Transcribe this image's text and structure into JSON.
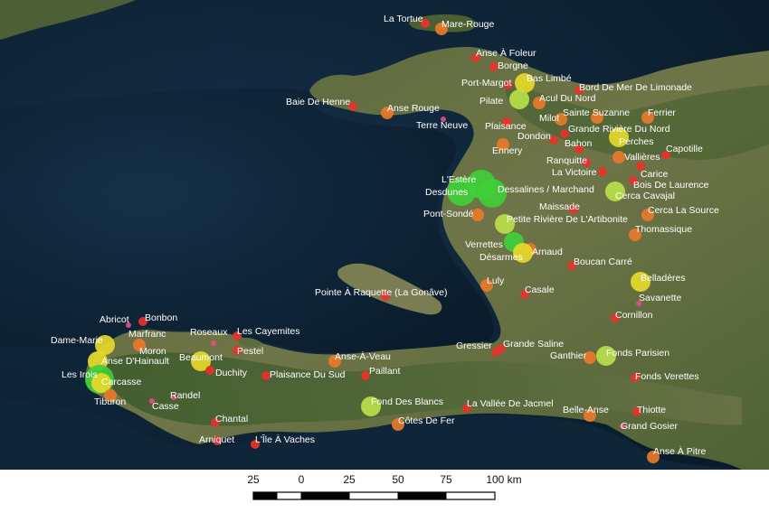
{
  "colors": {
    "ocean": "#0c2233",
    "land_dark": "#3f5430",
    "land_light": "#8a8f5f",
    "red": "#e8322b",
    "orange": "#e8782a",
    "amber": "#eea02c",
    "yellow": "#e6d92a",
    "yellowgreen": "#b8e04a",
    "green": "#3fcf3a",
    "pink": "#e84a8a"
  },
  "places": [
    {
      "name": "La Tortue",
      "cat": "red",
      "size": 1
    },
    {
      "name": "Mare-Rouge",
      "cat": "orange",
      "size": 2
    },
    {
      "name": "Anse À Foleur",
      "cat": "red",
      "size": 1
    },
    {
      "name": "Borgne",
      "cat": "red",
      "size": 1
    },
    {
      "name": "Port-Margot",
      "cat": "red",
      "size": 1
    },
    {
      "name": "Bas Limbé",
      "cat": "yellow",
      "size": 3
    },
    {
      "name": "Bord De Mer De Limonade",
      "cat": "red",
      "size": 1
    },
    {
      "name": "Baie De Henne",
      "cat": "red",
      "size": 1
    },
    {
      "name": "Anse Rouge",
      "cat": "orange",
      "size": 2
    },
    {
      "name": "Pilate",
      "cat": "yellowgreen",
      "size": 3
    },
    {
      "name": "Acul Du Nord",
      "cat": "orange",
      "size": 2
    },
    {
      "name": "Terre Neuve",
      "cat": "pink",
      "size": 0
    },
    {
      "name": "Plaisance",
      "cat": "red",
      "size": 1
    },
    {
      "name": "Milot",
      "cat": "orange",
      "size": 2
    },
    {
      "name": "Sainte Suzanne",
      "cat": "orange",
      "size": 2
    },
    {
      "name": "Ferrier",
      "cat": "orange",
      "size": 2
    },
    {
      "name": "Grande Rivière Du Nord",
      "cat": "red",
      "size": 1
    },
    {
      "name": "Dondon",
      "cat": "red",
      "size": 1
    },
    {
      "name": "Perches",
      "cat": "yellow",
      "size": 3
    },
    {
      "name": "Ennery",
      "cat": "orange",
      "size": 2
    },
    {
      "name": "Bahon",
      "cat": "red",
      "size": 1
    },
    {
      "name": "Capotille",
      "cat": "red",
      "size": 1
    },
    {
      "name": "Vallières",
      "cat": "orange",
      "size": 2
    },
    {
      "name": "Ranquitte",
      "cat": "red",
      "size": 1
    },
    {
      "name": "La Victoire",
      "cat": "red",
      "size": 1
    },
    {
      "name": "Carice",
      "cat": "red",
      "size": 1
    },
    {
      "name": "L'Estère",
      "cat": "green",
      "size": 4
    },
    {
      "name": "Bois De Laurence",
      "cat": "red",
      "size": 1
    },
    {
      "name": "Desdunes",
      "cat": "green",
      "size": 4
    },
    {
      "name": "Dessalines / Marchand",
      "cat": "green",
      "size": 4
    },
    {
      "name": "Cerca Cavajal",
      "cat": "yellowgreen",
      "size": 3
    },
    {
      "name": "Maissade",
      "cat": "red",
      "size": 1
    },
    {
      "name": "Pont-Sondé",
      "cat": "orange",
      "size": 2
    },
    {
      "name": "Cerca La Source",
      "cat": "orange",
      "size": 2
    },
    {
      "name": "Petite Rivière De L'Artibonite",
      "cat": "yellowgreen",
      "size": 3
    },
    {
      "name": "Thomassique",
      "cat": "orange",
      "size": 2
    },
    {
      "name": "Verrettes",
      "cat": "green",
      "size": 3
    },
    {
      "name": "Arnaud",
      "cat": "orange",
      "size": 2
    },
    {
      "name": "Désarmes",
      "cat": "yellow",
      "size": 3
    },
    {
      "name": "Boucan Carré",
      "cat": "red",
      "size": 1
    },
    {
      "name": "Belladères",
      "cat": "yellow",
      "size": 3
    },
    {
      "name": "Luly",
      "cat": "orange",
      "size": 2
    },
    {
      "name": "Casale",
      "cat": "red",
      "size": 1
    },
    {
      "name": "Savanette",
      "cat": "pink",
      "size": 0
    },
    {
      "name": "Pointe À Raquette (La Gonâve)",
      "cat": "red",
      "size": 1
    },
    {
      "name": "Cornillon",
      "cat": "red",
      "size": 1
    },
    {
      "name": "Abricot",
      "cat": "pink",
      "size": 0
    },
    {
      "name": "Bonbon",
      "cat": "red",
      "size": 1
    },
    {
      "name": "Roseaux",
      "cat": "pink",
      "size": 0
    },
    {
      "name": "Les Cayemites",
      "cat": "red",
      "size": 1
    },
    {
      "name": "Dame-Marie",
      "cat": "yellow",
      "size": 3
    },
    {
      "name": "Marfranc",
      "cat": "red",
      "size": 1
    },
    {
      "name": "Moron",
      "cat": "orange",
      "size": 2
    },
    {
      "name": "Pestel",
      "cat": "red",
      "size": 1
    },
    {
      "name": "Anse D'Hainault",
      "cat": "yellow",
      "size": 3
    },
    {
      "name": "Beaumont",
      "cat": "yellow",
      "size": 3
    },
    {
      "name": "Anse-À-Veau",
      "cat": "orange",
      "size": 2
    },
    {
      "name": "Gressier",
      "cat": "red",
      "size": 1
    },
    {
      "name": "Grande Saline",
      "cat": "red",
      "size": 1
    },
    {
      "name": "Fonds Parisien",
      "cat": "yellowgreen",
      "size": 3
    },
    {
      "name": "Duchity",
      "cat": "red",
      "size": 1
    },
    {
      "name": "Ganthier",
      "cat": "orange",
      "size": 2
    },
    {
      "name": "Les Irois",
      "cat": "green",
      "size": 4
    },
    {
      "name": "Carcasse",
      "cat": "yellow",
      "size": 3
    },
    {
      "name": "Plaisance Du Sud",
      "cat": "red",
      "size": 1
    },
    {
      "name": "Paillant",
      "cat": "red",
      "size": 1
    },
    {
      "name": "Fonds Verettes",
      "cat": "red",
      "size": 1
    },
    {
      "name": "Randel",
      "cat": "pink",
      "size": 0
    },
    {
      "name": "Tiburon",
      "cat": "orange",
      "size": 2
    },
    {
      "name": "Casse",
      "cat": "pink",
      "size": 0
    },
    {
      "name": "Fond Des Blancs",
      "cat": "yellowgreen",
      "size": 3
    },
    {
      "name": "La Vallée De Jacmel",
      "cat": "red",
      "size": 1
    },
    {
      "name": "Belle-Anse",
      "cat": "orange",
      "size": 2
    },
    {
      "name": "Thiotte",
      "cat": "red",
      "size": 1
    },
    {
      "name": "Côtes De Fer",
      "cat": "orange",
      "size": 2
    },
    {
      "name": "Chantal",
      "cat": "red",
      "size": 1
    },
    {
      "name": "Grand Gosier",
      "cat": "pink",
      "size": 0
    },
    {
      "name": "Arniquet",
      "cat": "red",
      "size": 1
    },
    {
      "name": "L'Île À Vaches",
      "cat": "red",
      "size": 1
    },
    {
      "name": "Anse À Pitre",
      "cat": "orange",
      "size": 2
    }
  ],
  "scale_bar": {
    "ticks": [
      "25",
      "0",
      "25",
      "50",
      "75",
      "100 km"
    ]
  }
}
